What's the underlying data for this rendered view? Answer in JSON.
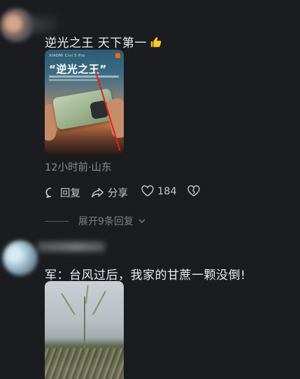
{
  "comment1": {
    "text": "逆光之王  天下第一",
    "emoji": "thumbs-up-emoji",
    "image": {
      "brand": "XIAOMI Civi 5 Pro",
      "headline": "“逆光之王”"
    },
    "meta": "12小时前·山东",
    "actions": {
      "reply": "回复",
      "share": "分享",
      "likes": "184"
    },
    "expand_replies": "展开9条回复"
  },
  "comment2": {
    "text": "军：台风过后，我家的甘蔗一颗没倒!"
  },
  "colors": {
    "background": "#1b1c20",
    "primary_text": "#ececf0",
    "secondary_text": "#8d8e94",
    "annotation_red": "#e51d1d"
  }
}
